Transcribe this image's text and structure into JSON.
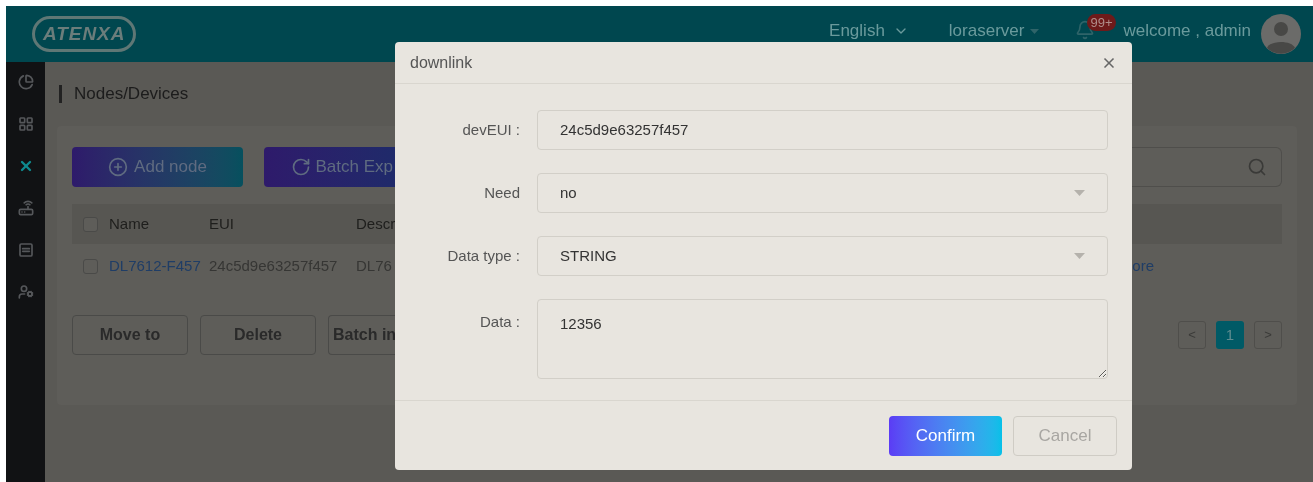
{
  "header": {
    "logo": "ATENXA",
    "language": "English",
    "server": "loraserver",
    "notification_count": "99+",
    "welcome": "welcome , admin"
  },
  "sidebar": {
    "items": [
      {
        "kind": "chart",
        "selected": false
      },
      {
        "kind": "grid",
        "selected": false
      },
      {
        "kind": "nodes",
        "selected": true
      },
      {
        "kind": "router",
        "selected": false
      },
      {
        "kind": "list",
        "selected": false
      },
      {
        "kind": "user",
        "selected": false
      }
    ]
  },
  "breadcrumb": "Nodes/Devices",
  "toolbar": {
    "buttons": [
      "Add node",
      "Batch Exp"
    ]
  },
  "table": {
    "header_checked": false,
    "columns": [
      "Name",
      "EUI",
      "Descr"
    ],
    "rows": [
      {
        "checked": false,
        "cells": [
          "DL7612-F457",
          "24c5d9e63257f457",
          "DL76"
        ],
        "action": "ore"
      }
    ]
  },
  "bulk_actions": [
    "Move to",
    "Delete",
    "Batch in"
  ],
  "pagination": {
    "prev": "<",
    "pages": [
      {
        "label": "1",
        "selected": true
      }
    ],
    "next": ">"
  },
  "dialog": {
    "title": "downlink",
    "fields": [
      {
        "kind": "text",
        "label": "devEUI :",
        "value": "24c5d9e63257f457"
      },
      {
        "kind": "select",
        "label": "Need",
        "value": "no"
      },
      {
        "kind": "select",
        "label": "Data type :",
        "value": "STRING"
      },
      {
        "kind": "textarea",
        "label": "Data :",
        "value": "12356"
      }
    ],
    "buttons": [
      {
        "kind": "primary",
        "label": "Confirm"
      },
      {
        "kind": "secondary",
        "label": "Cancel"
      }
    ]
  }
}
